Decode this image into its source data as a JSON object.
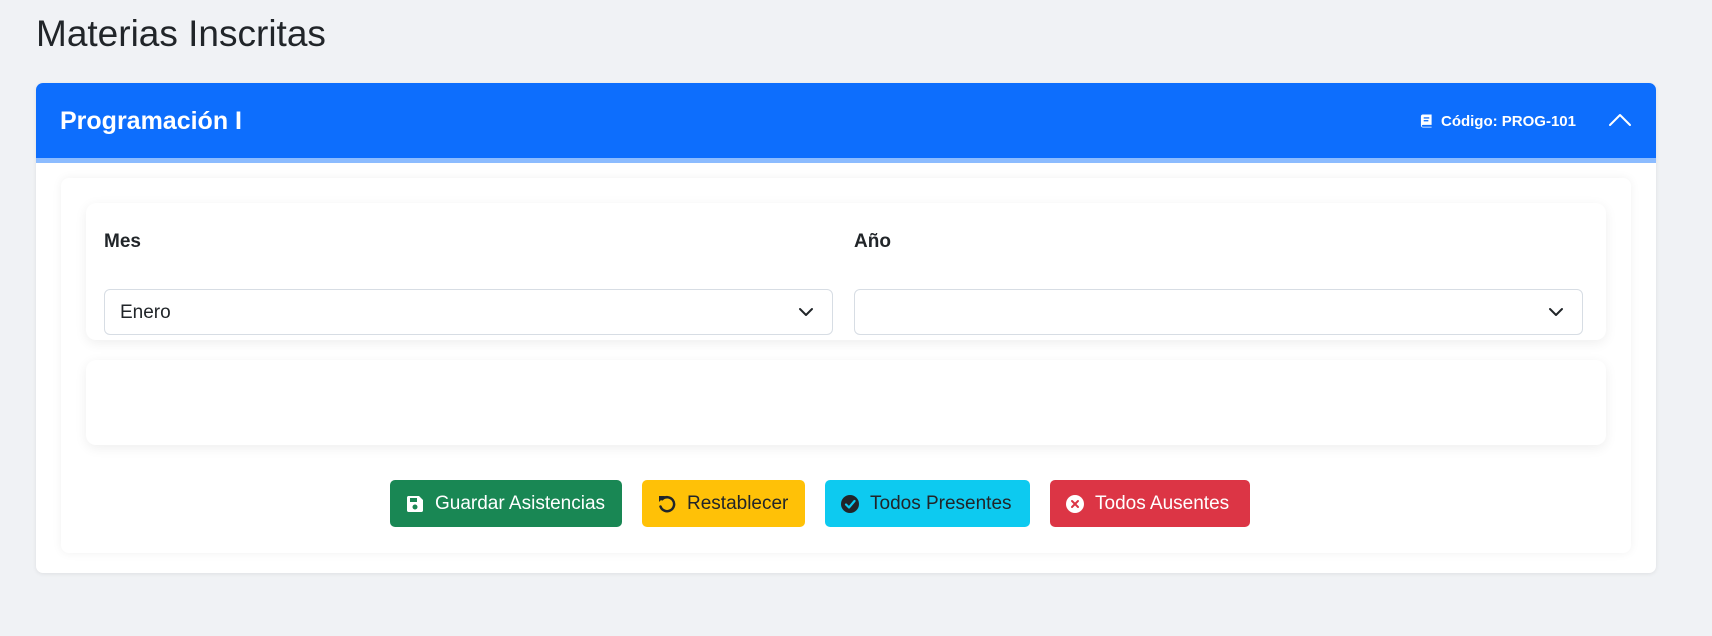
{
  "page": {
    "title": "Materias Inscritas"
  },
  "course": {
    "name": "Programación I",
    "code_label": "Código: PROG-101",
    "colors": {
      "header": "#0d6efd"
    }
  },
  "filters": {
    "month": {
      "label": "Mes",
      "selected": "Enero"
    },
    "year": {
      "label": "Año",
      "selected": ""
    }
  },
  "actions": {
    "save_label": "Guardar Asistencias",
    "reset_label": "Restablecer",
    "present_label": "Todos Presentes",
    "absent_label": "Todos Ausentes",
    "colors": {
      "save": "#198754",
      "reset": "#ffc107",
      "present": "#0dcaf0",
      "absent": "#dc3545"
    }
  },
  "icons": {
    "code": "book-icon",
    "collapse": "chevron-up-icon",
    "select": "chevron-down-icon",
    "save": "floppy-disk-icon",
    "reset": "rotate-left-icon",
    "present": "check-circle-icon",
    "absent": "x-circle-icon"
  }
}
